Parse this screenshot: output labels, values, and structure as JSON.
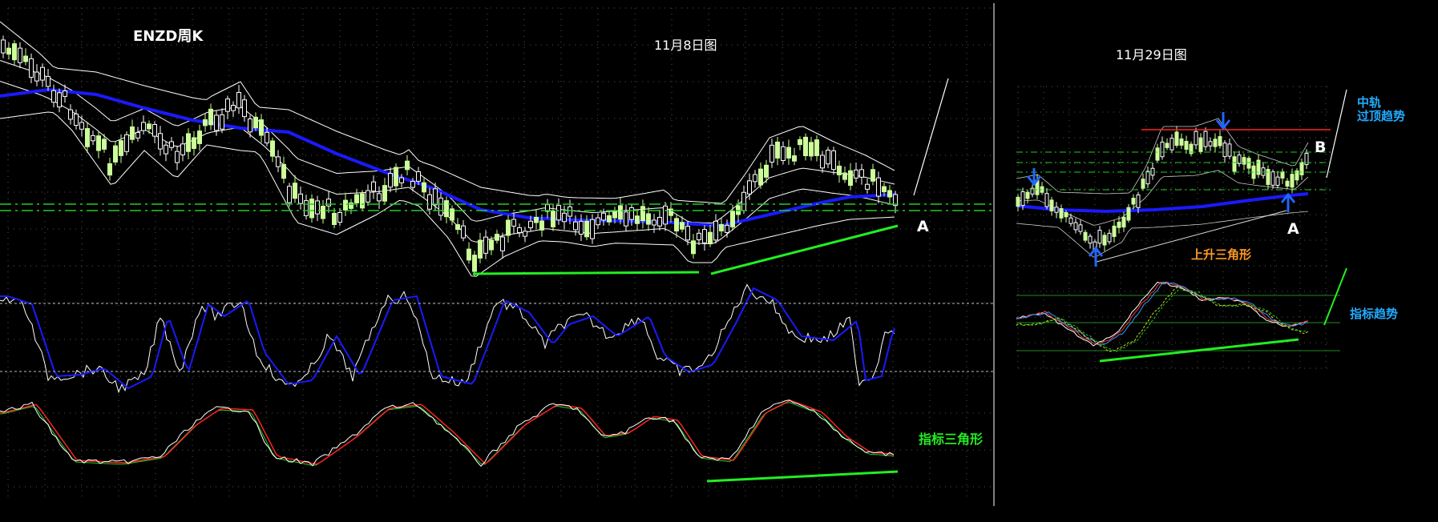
{
  "left_panel": {
    "title": "ENZD周K",
    "date_label": "11月8日图",
    "label_a": "A",
    "indicator_label": "指标三角形"
  },
  "right_panel": {
    "date_label": "11月29日图",
    "mid_band_label_1": "中轨",
    "mid_band_label_2": "过顶趋势",
    "label_a": "A",
    "label_b": "B",
    "triangle_label": "上升三角形",
    "indicator_label": "指标趋势"
  },
  "colors": {
    "background": "#000000",
    "bull_candle": "#ccff99",
    "bear_candle": "#ffffff",
    "mid_band": "#1a1aff",
    "band_lines": "#ffffff",
    "trend_green": "#22ee22",
    "dashed_green": "#22cc22",
    "red_line": "#ff2222",
    "label_white": "#ffffff",
    "label_green": "#22ee22",
    "label_orange": "#ff9922",
    "label_cyan": "#22aaff",
    "grid": "#555555"
  },
  "chart_data": [
    {
      "type": "candlestick",
      "name": "left-price",
      "annotations": [
        "ENZD周K",
        "11月8日图",
        "A"
      ]
    },
    {
      "type": "line",
      "name": "left-oscillator-1",
      "series_colors": [
        "#ffffff",
        "#1a1aff"
      ]
    },
    {
      "type": "line",
      "name": "left-oscillator-2",
      "series_colors": [
        "#ffffff",
        "#ff2222",
        "#22cc22"
      ],
      "annotations": [
        "指标三角形"
      ]
    },
    {
      "type": "candlestick",
      "name": "right-price",
      "annotations": [
        "11月29日图",
        "中轨",
        "过顶趋势",
        "A",
        "B",
        "上升三角形"
      ]
    },
    {
      "type": "line",
      "name": "right-oscillator",
      "annotations": [
        "指标趋势"
      ]
    }
  ]
}
